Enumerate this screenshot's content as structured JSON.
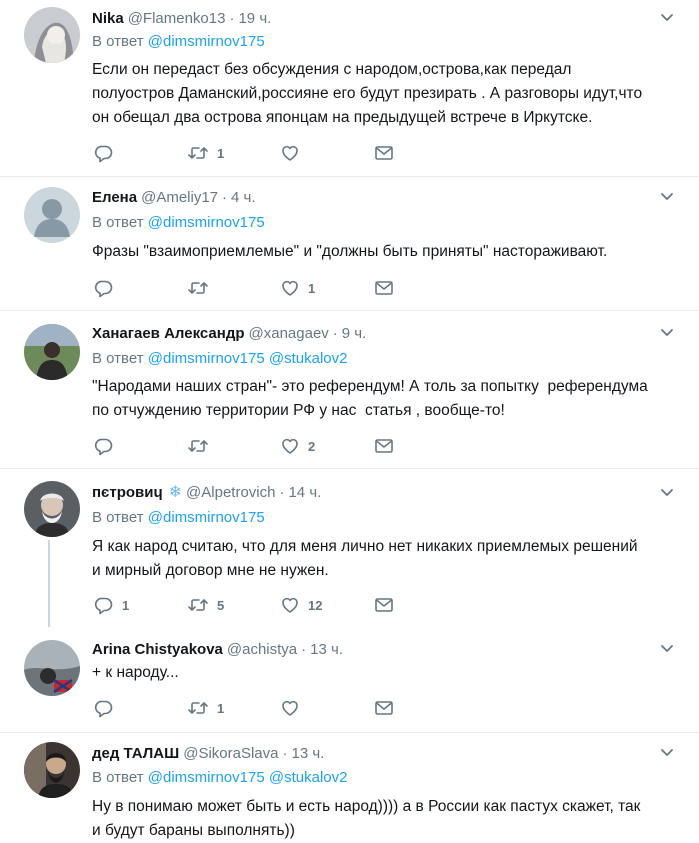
{
  "reply_prefix": "В ответ",
  "colors": {
    "link": "#1da1f2",
    "muted": "#657786",
    "text": "#14171a",
    "separator": "#e6ecf0"
  },
  "icons": [
    "reply-icon",
    "retweet-icon",
    "like-icon",
    "direct-message-icon",
    "chevron-down-icon",
    "snowflake-icon"
  ],
  "tweets": [
    {
      "name": "Nika",
      "handle": "@Flamenko13",
      "time": "19 ч.",
      "mentions": [
        "@dimsmirnov175"
      ],
      "text": "Если он передаст без обсуждения с народом,острова,как передал\nполуостров Даманский,россияне его будут презирать . А разговоры идут,что\nон обещал два острова японцам на предыдущей встрече в Иркутске.",
      "replies": "",
      "retweets": "1",
      "likes": ""
    },
    {
      "name": "Елена",
      "handle": "@Ameliy17",
      "time": "4 ч.",
      "mentions": [
        "@dimsmirnov175"
      ],
      "text": "Фразы \"взаимоприемлемые\" и \"должны быть приняты\" настораживают.",
      "replies": "",
      "retweets": "",
      "likes": "1"
    },
    {
      "name": "Ханагаев Александр",
      "handle": "@xanagaev",
      "time": "9 ч.",
      "mentions": [
        "@dimsmirnov175",
        "@stukalov2"
      ],
      "text": "\"Народами наших стран\"- это референдум! А толь за попытку  референдума\nпо отчуждению территории РФ у нас  статья , вообще-то!",
      "replies": "",
      "retweets": "",
      "likes": "2"
    },
    {
      "name": "пєтровиɥ",
      "snowflake": "❄",
      "handle": "@Alpetrovich",
      "time": "14 ч.",
      "mentions": [
        "@dimsmirnov175"
      ],
      "text": "Я как народ считаю, что для меня лично нет никаких приемлемых решений\nи мирный договор мне не нужен.",
      "replies": "1",
      "retweets": "5",
      "likes": "12"
    },
    {
      "name": "Arina Chistyakova",
      "handle": "@achistya",
      "time": "13 ч.",
      "mentions": [],
      "text": "+ к народу...",
      "replies": "",
      "retweets": "1",
      "likes": ""
    },
    {
      "name": "дед ТАЛАШ",
      "handle": "@SikoraSlava",
      "time": "13 ч.",
      "mentions": [
        "@dimsmirnov175",
        "@stukalov2"
      ],
      "text": "Ну в понимаю может быть и есть народ)))) а в России как пастух скажет, так\nи будут бараны выполнять))",
      "replies": "",
      "retweets": "",
      "likes": ""
    }
  ]
}
